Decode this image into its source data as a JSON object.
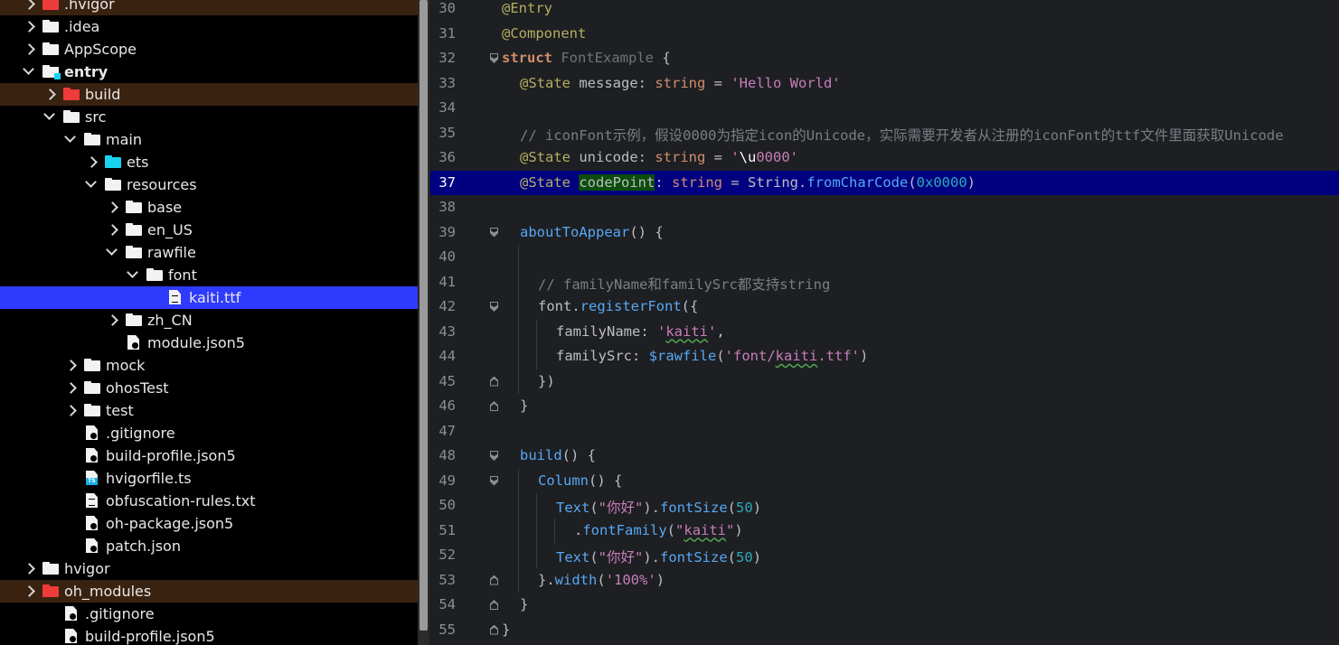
{
  "tree": [
    {
      "label": ".hvigor",
      "icon": "folder-red-icon",
      "chev": "r",
      "depth": 0,
      "excluded": true
    },
    {
      "label": ".idea",
      "icon": "folder-icon",
      "chev": "r",
      "depth": 0
    },
    {
      "label": "AppScope",
      "icon": "folder-icon",
      "chev": "r",
      "depth": 0
    },
    {
      "label": "entry",
      "icon": "module-folder-icon",
      "chev": "d",
      "depth": 0,
      "bold": true
    },
    {
      "label": "build",
      "icon": "folder-red-icon",
      "chev": "r",
      "depth": 1,
      "excluded": true
    },
    {
      "label": "src",
      "icon": "folder-icon",
      "chev": "d",
      "depth": 1
    },
    {
      "label": "main",
      "icon": "folder-icon",
      "chev": "d",
      "depth": 2
    },
    {
      "label": "ets",
      "icon": "folder-cyan-icon",
      "chev": "r",
      "depth": 3
    },
    {
      "label": "resources",
      "icon": "folder-icon",
      "chev": "d",
      "depth": 3
    },
    {
      "label": "base",
      "icon": "folder-icon",
      "chev": "r",
      "depth": 4
    },
    {
      "label": "en_US",
      "icon": "folder-icon",
      "chev": "r",
      "depth": 4
    },
    {
      "label": "rawfile",
      "icon": "folder-icon",
      "chev": "d",
      "depth": 4
    },
    {
      "label": "font",
      "icon": "folder-icon",
      "chev": "d",
      "depth": 5
    },
    {
      "label": "kaiti.ttf",
      "icon": "file-icon",
      "chev": "",
      "depth": 6,
      "selected": true
    },
    {
      "label": "zh_CN",
      "icon": "folder-icon",
      "chev": "r",
      "depth": 4
    },
    {
      "label": "module.json5",
      "icon": "json-file-icon",
      "chev": "",
      "depth": 4,
      "noarrow": true
    },
    {
      "label": "mock",
      "icon": "folder-icon",
      "chev": "r",
      "depth": 2
    },
    {
      "label": "ohosTest",
      "icon": "folder-icon",
      "chev": "r",
      "depth": 2
    },
    {
      "label": "test",
      "icon": "folder-icon",
      "chev": "r",
      "depth": 2
    },
    {
      "label": ".gitignore",
      "icon": "gitignore-file-icon",
      "chev": "",
      "depth": 2,
      "noarrow": true
    },
    {
      "label": "build-profile.json5",
      "icon": "json-file-icon",
      "chev": "",
      "depth": 2,
      "noarrow": true
    },
    {
      "label": "hvigorfile.ts",
      "icon": "ts-file-icon",
      "chev": "",
      "depth": 2,
      "noarrow": true
    },
    {
      "label": "obfuscation-rules.txt",
      "icon": "text-file-icon",
      "chev": "",
      "depth": 2,
      "noarrow": true
    },
    {
      "label": "oh-package.json5",
      "icon": "json-file-icon",
      "chev": "",
      "depth": 2,
      "noarrow": true
    },
    {
      "label": "patch.json",
      "icon": "json-file-icon",
      "chev": "",
      "depth": 2,
      "noarrow": true
    },
    {
      "label": "hvigor",
      "icon": "folder-icon",
      "chev": "r",
      "depth": 0
    },
    {
      "label": "oh_modules",
      "icon": "folder-red-icon",
      "chev": "r",
      "depth": 0,
      "excluded": true
    },
    {
      "label": ".gitignore",
      "icon": "gitignore-file-icon",
      "chev": "",
      "depth": 1,
      "noarrow": true
    },
    {
      "label": "build-profile.json5",
      "icon": "json-file-icon",
      "chev": "",
      "depth": 1,
      "noarrow": true
    }
  ],
  "editor": {
    "current_line": "37",
    "lines": [
      {
        "n": "30",
        "indent": 0,
        "tokens": [
          [
            "ann",
            "@Entry"
          ]
        ]
      },
      {
        "n": "31",
        "indent": 0,
        "tokens": [
          [
            "ann",
            "@Component"
          ]
        ]
      },
      {
        "n": "32",
        "indent": 0,
        "fold": "open",
        "tokens": [
          [
            "kw",
            "struct "
          ],
          [
            "cls",
            "FontExample "
          ],
          [
            "plain",
            "{"
          ]
        ]
      },
      {
        "n": "33",
        "indent": 1,
        "tokens": [
          [
            "ann",
            "@State "
          ],
          [
            "plain",
            "message: "
          ],
          [
            "kwp",
            "string "
          ],
          [
            "plain",
            "= "
          ],
          [
            "strp",
            "'Hello World'"
          ]
        ]
      },
      {
        "n": "34",
        "indent": 1,
        "tokens": []
      },
      {
        "n": "35",
        "indent": 1,
        "tokens": [
          [
            "cmt",
            "// iconFont示例，假设0000为指定icon的Unicode，实际需要开发者从注册的iconFont的ttf文件里面获取Unicode"
          ]
        ]
      },
      {
        "n": "36",
        "indent": 1,
        "tokens": [
          [
            "ann",
            "@State "
          ],
          [
            "plain",
            "unicode: "
          ],
          [
            "kwp",
            "string "
          ],
          [
            "plain",
            "= "
          ],
          [
            "strp",
            "'"
          ],
          [
            "white",
            "\\u"
          ],
          [
            "strp",
            "0000'"
          ]
        ]
      },
      {
        "n": "37",
        "indent": 1,
        "tokens": [
          [
            "ann",
            "@State "
          ],
          [
            "hl",
            "codePoint"
          ],
          [
            "plain",
            ": "
          ],
          [
            "kwp",
            "string "
          ],
          [
            "plain",
            "= String."
          ],
          [
            "fn",
            "fromCharCode"
          ],
          [
            "plain",
            "("
          ],
          [
            "num",
            "0x0000"
          ],
          [
            "plain",
            ")"
          ]
        ]
      },
      {
        "n": "38",
        "indent": 1,
        "tokens": []
      },
      {
        "n": "39",
        "indent": 1,
        "fold": "open",
        "tokens": [
          [
            "fn",
            "aboutToAppear"
          ],
          [
            "plain",
            "() {"
          ]
        ]
      },
      {
        "n": "40",
        "indent": 2,
        "tokens": []
      },
      {
        "n": "41",
        "indent": 2,
        "tokens": [
          [
            "cmt",
            "// familyName和familySrc都支持string"
          ]
        ]
      },
      {
        "n": "42",
        "indent": 2,
        "fold": "open",
        "tokens": [
          [
            "plain",
            "font."
          ],
          [
            "fn",
            "registerFont"
          ],
          [
            "plain",
            "({"
          ]
        ]
      },
      {
        "n": "43",
        "indent": 3,
        "tokens": [
          [
            "plain",
            "familyName: "
          ],
          [
            "strp",
            "'"
          ],
          [
            "typo",
            "kaiti"
          ],
          [
            "strp",
            "'"
          ],
          [
            "plain",
            ","
          ]
        ]
      },
      {
        "n": "44",
        "indent": 3,
        "tokens": [
          [
            "plain",
            "familySrc: "
          ],
          [
            "fn",
            "$rawfile"
          ],
          [
            "plain",
            "("
          ],
          [
            "strp",
            "'font/"
          ],
          [
            "typo",
            "kaiti"
          ],
          [
            "strp",
            ".ttf'"
          ],
          [
            "plain",
            ")"
          ]
        ]
      },
      {
        "n": "45",
        "indent": 2,
        "fold": "close",
        "tokens": [
          [
            "plain",
            "})"
          ]
        ]
      },
      {
        "n": "46",
        "indent": 1,
        "fold": "close",
        "tokens": [
          [
            "plain",
            "}"
          ]
        ]
      },
      {
        "n": "47",
        "indent": 1,
        "tokens": []
      },
      {
        "n": "48",
        "indent": 1,
        "fold": "open",
        "tokens": [
          [
            "fn",
            "build"
          ],
          [
            "plain",
            "() {"
          ]
        ]
      },
      {
        "n": "49",
        "indent": 2,
        "fold": "open",
        "tokens": [
          [
            "fn",
            "Column"
          ],
          [
            "plain",
            "() {"
          ]
        ]
      },
      {
        "n": "50",
        "indent": 3,
        "tokens": [
          [
            "fn",
            "Text"
          ],
          [
            "plain",
            "("
          ],
          [
            "strp",
            "\"你好\""
          ],
          [
            "plain",
            ")."
          ],
          [
            "fn",
            "fontSize"
          ],
          [
            "plain",
            "("
          ],
          [
            "num",
            "50"
          ],
          [
            "plain",
            ")"
          ]
        ]
      },
      {
        "n": "51",
        "indent": 4,
        "tokens": [
          [
            "plain",
            "."
          ],
          [
            "fn",
            "fontFamily"
          ],
          [
            "plain",
            "("
          ],
          [
            "strp",
            "\""
          ],
          [
            "typo",
            "kaiti"
          ],
          [
            "strp",
            "\""
          ],
          [
            "plain",
            ")"
          ]
        ]
      },
      {
        "n": "52",
        "indent": 3,
        "tokens": [
          [
            "fn",
            "Text"
          ],
          [
            "plain",
            "("
          ],
          [
            "strp",
            "\"你好\""
          ],
          [
            "plain",
            ")."
          ],
          [
            "fn",
            "fontSize"
          ],
          [
            "plain",
            "("
          ],
          [
            "num",
            "50"
          ],
          [
            "plain",
            ")"
          ]
        ]
      },
      {
        "n": "53",
        "indent": 2,
        "fold": "close",
        "tokens": [
          [
            "plain",
            "}."
          ],
          [
            "fn",
            "width"
          ],
          [
            "plain",
            "("
          ],
          [
            "strp",
            "'100%'"
          ],
          [
            "plain",
            ")"
          ]
        ]
      },
      {
        "n": "54",
        "indent": 1,
        "fold": "close",
        "tokens": [
          [
            "plain",
            "}"
          ]
        ]
      },
      {
        "n": "55",
        "indent": 0,
        "fold": "close",
        "tokens": [
          [
            "plain",
            "}"
          ]
        ]
      }
    ]
  }
}
